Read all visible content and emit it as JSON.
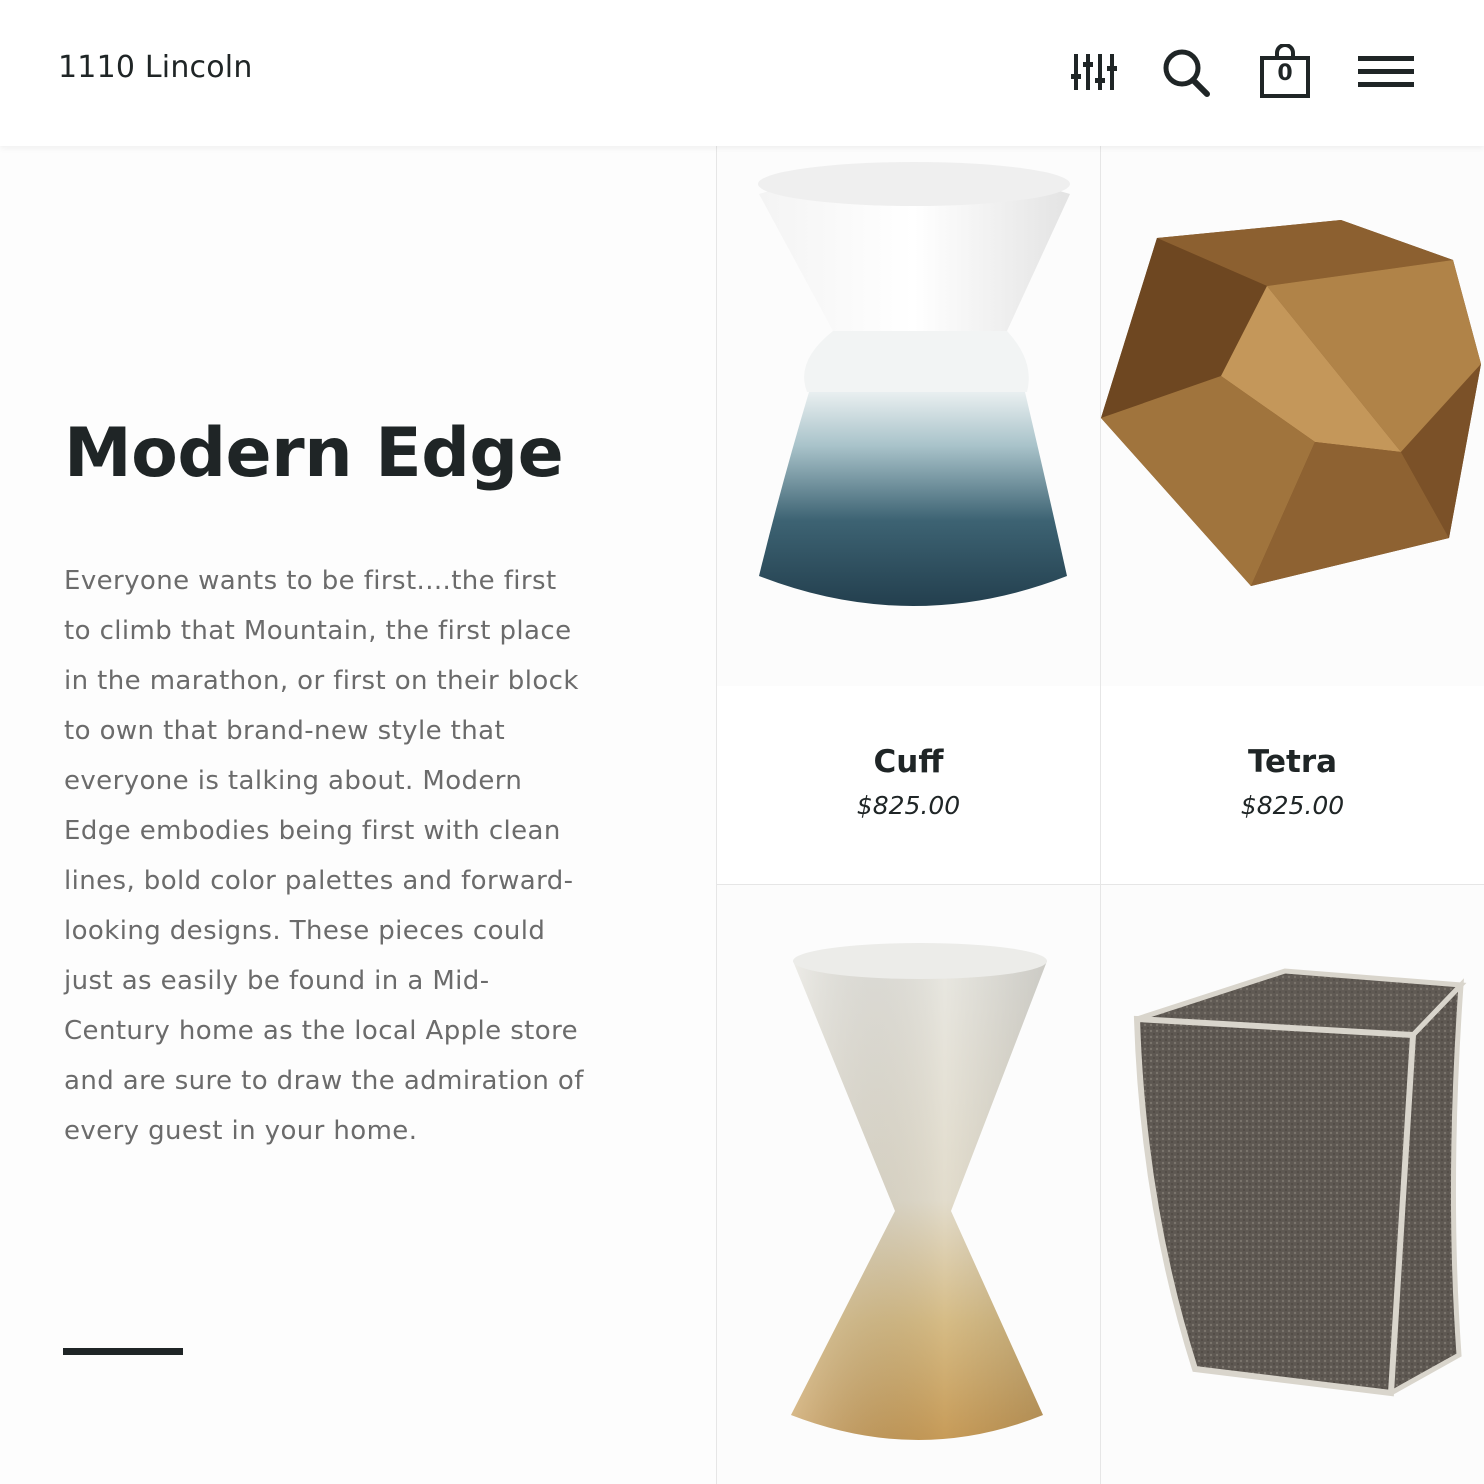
{
  "header": {
    "brand": "1110 Lincoln",
    "cart_count": "0",
    "icons": [
      "filter-sliders-icon",
      "search-icon",
      "shopping-bag-icon",
      "hamburger-menu-icon"
    ]
  },
  "collection": {
    "title": "Modern Edge",
    "description": "Everyone wants to be first....the first to climb that Mountain, the first place in the marathon, or first on their block to own that brand-new style that everyone is talking about. Modern Edge embodies being first with clean lines, bold color palettes and forward-looking designs. These pieces could just as easily be found in a Mid-Century home as the local Apple store and are sure to draw the admiration of every guest in your home."
  },
  "products": [
    {
      "name": "Cuff",
      "price": "$825.00"
    },
    {
      "name": "Tetra",
      "price": "$825.00"
    },
    {
      "name": "",
      "price": ""
    },
    {
      "name": "",
      "price": ""
    }
  ],
  "colors": {
    "text_dark": "#1f2526",
    "text_muted": "#6b6b6b",
    "divider": "#e6e6e6"
  }
}
